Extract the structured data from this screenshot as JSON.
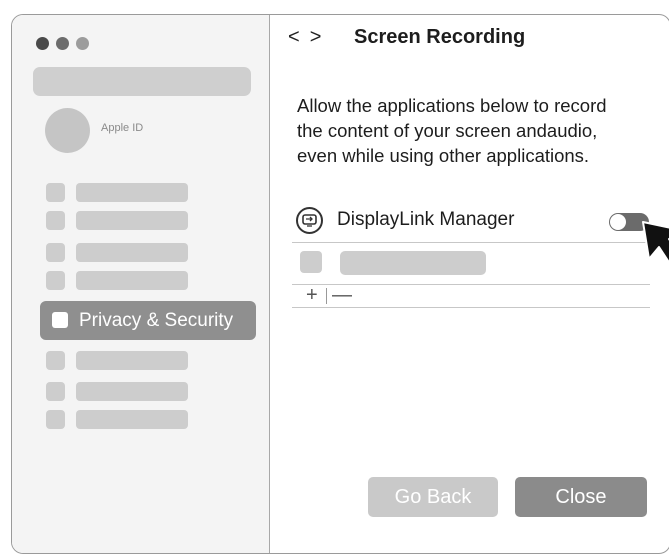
{
  "sidebar": {
    "apple_id_label": "Apple ID",
    "selected_item": "Privacy & Security"
  },
  "header": {
    "back": "<",
    "forward": ">",
    "title": "Screen Recording"
  },
  "main": {
    "description": "Allow the applications below to record the content of your screen andaudio, even while using other applications.",
    "apps": [
      {
        "name": "DisplayLink Manager",
        "enabled": false
      }
    ],
    "add_label": "+",
    "remove_label": "—"
  },
  "footer": {
    "go_back_label": "Go Back",
    "close_label": "Close"
  }
}
